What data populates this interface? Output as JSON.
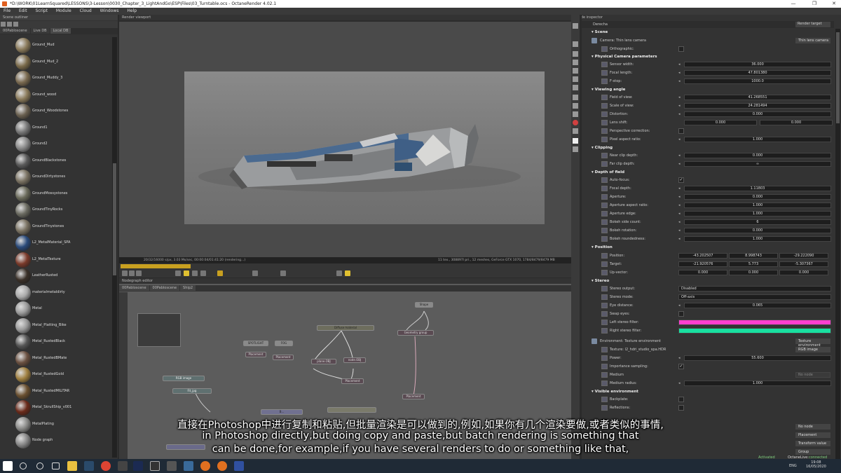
{
  "window": {
    "title": "*D:\\WORK\\01LearnSquared\\LESSONS\\3-Lesson\\0030_Chapter_3_LightAndGo\\ESP\\Files\\03_Turntable.ocs - OctaneRender 4.02.1"
  },
  "menu": [
    "File",
    "Edit",
    "Script",
    "Module",
    "Cloud",
    "Windows",
    "Help"
  ],
  "outliner": {
    "title": "Scene outliner",
    "tabs": [
      "00Pabloscene",
      "Live DB",
      "Local DB"
    ],
    "items": [
      "Ground_Mud",
      "Ground_Mud_2",
      "Ground_Muddy_3",
      "Ground_wood",
      "Ground_Woodstones",
      "Ground1",
      "Ground2",
      "GroundBlackstones",
      "GroundDirtystones",
      "GroundMossystones",
      "GroundTinyRocks",
      "GroundTinystones",
      "L2_MetalMaterial_SPA",
      "L2_MetalTexture",
      "LeatherRusted",
      "materialmetaldirty",
      "Metal",
      "Metal_Platting_Bike",
      "Metal_RustedBlack",
      "Metal_RustedBMate",
      "Metal_RustedGold",
      "Metal_RustedMILITAR",
      "Metal_SkrullShip_v001",
      "MetalPlating",
      "Node graph"
    ]
  },
  "viewport": {
    "title": "Render viewport",
    "status_left": "20/32/16000 s/px, 3.03 Ms/sec, 00:00:04/01:41:20 (rendering...)",
    "status_right": "11 tex., 308897l pri., 12 meshes, GeForce GTX 1070, 1784/8479/8479 MB"
  },
  "nodegraph": {
    "title": "Nodegraph editor",
    "tabs": [
      "00Pabloscene",
      "00Pabloscene",
      "Ship2"
    ],
    "nodes": {
      "spotlight": "SPOTLIGHT",
      "fog": "FOG",
      "placement1": "Placement",
      "placement2": "Placement",
      "diffuse": "Diffuse material",
      "geometry_group": "Geometry group",
      "shape": "Shape",
      "plane": "plane.OBJ",
      "node": "node.OBJ",
      "placement3": "Placement",
      "placement4": "Placement",
      "rgb_image": "RGB image",
      "fit": "Fit_jpg",
      "bmesh": "B..."
    }
  },
  "inspector": {
    "title": "Node inspector",
    "object": "Derecha",
    "render_target": "Render target",
    "scene_label": "Scene",
    "camera_label": "Camera: Thin lens camera",
    "camera_type": "Thin lens camera",
    "rows": {
      "orthographic": "Orthographic:",
      "phys_section": "Physical Camera parameters",
      "sensor_width": "Sensor width:",
      "sensor_width_v": "36.000",
      "focal_length": "Focal length:",
      "focal_length_v": "47.801380",
      "fstop": "F-stop:",
      "fstop_v": "1000.0",
      "viewing_section": "Viewing angle",
      "fov": "Field of view:",
      "fov_v": "41.268551",
      "scale": "Scale of view:",
      "scale_v": "24.281494",
      "distortion": "Distortion:",
      "distortion_v": "0.000",
      "lens_shift": "Lens shift:",
      "lens_shift_x": "0.000",
      "lens_shift_y": "0.000",
      "persp": "Perspective correction:",
      "pixel_aspect": "Pixel aspect ratio:",
      "pixel_aspect_v": "1.000",
      "clip_section": "Clipping",
      "near_clip": "Near clip depth:",
      "near_clip_v": "0.000",
      "far_clip": "Far clip depth:",
      "far_clip_v": "∞",
      "dof_section": "Depth of field",
      "autofocus": "Auto-focus:",
      "focal_depth": "Focal depth:",
      "focal_depth_v": "1.11803",
      "aperture": "Aperture:",
      "aperture_v": "0.000",
      "aperture_ar": "Aperture aspect ratio:",
      "aperture_ar_v": "1.000",
      "aperture_edge": "Aperture edge:",
      "aperture_edge_v": "1.000",
      "bokeh_count": "Bokeh side count:",
      "bokeh_count_v": "6",
      "bokeh_rot": "Bokeh rotation:",
      "bokeh_rot_v": "0.000",
      "bokeh_round": "Bokeh roundedness:",
      "bokeh_round_v": "1.000",
      "pos_section": "Position",
      "position": "Position:",
      "position_x": "-43.202507",
      "position_y": "8.998743",
      "position_z": "-29.222090",
      "target": "Target:",
      "target_x": "-21.920576",
      "target_y": "5.773",
      "target_z": "-5.307367",
      "upvector": "Up-vector:",
      "upvector_x": "0.000",
      "upvector_y": "0.000",
      "upvector_z": "0.000",
      "stereo_section": "Stereo",
      "stereo_output": "Stereo output:",
      "stereo_output_v": "Disabled",
      "stereo_mode": "Stereo mode:",
      "stereo_mode_v": "Off-axis",
      "eye_distance": "Eye distance:",
      "eye_distance_v": "0.065",
      "swap_eyes": "Swap eyes:",
      "left_filter": "Left stereo filter:",
      "right_filter": "Right stereo filter:",
      "env_label": "Environment: Texture environment",
      "env_type": "Texture environment",
      "texture": "Texture: l2_hdri_studio_spa.HDR",
      "texture_type": "RGB image",
      "power": "Power:",
      "power_v": "55.600",
      "importance": "Importance sampling:",
      "medium": "Medium",
      "medium_v": "No node",
      "medium_radius": "Medium radius:",
      "medium_radius_v": "1.000",
      "vis_section": "Visible environment",
      "backplate": "Backplate:",
      "reflections": "Reflections:",
      "no_node": "No node",
      "placement": "Placement",
      "transform": "Transform value",
      "group": "Group"
    },
    "colors": {
      "left_filter": "#ff3fcf",
      "right_filter": "#19e0a0"
    }
  },
  "subtitles": {
    "line1": "直接在Photoshop中进行复制和粘贴,但批量渲染是可以做到的,例如,如果你有几个渲染要做,或者类似的事情,",
    "line2": "in Photoshop directly,but doing copy and paste,but batch rendering is something that",
    "line3": "can be done,for example,if you have several renders to do or something like that,"
  },
  "taskbar": {
    "octane_status": "OctaneLive:",
    "activated": "Activated",
    "connected": "connected",
    "lang": "ENG",
    "time": "19:08",
    "date": "16/05/2020"
  }
}
